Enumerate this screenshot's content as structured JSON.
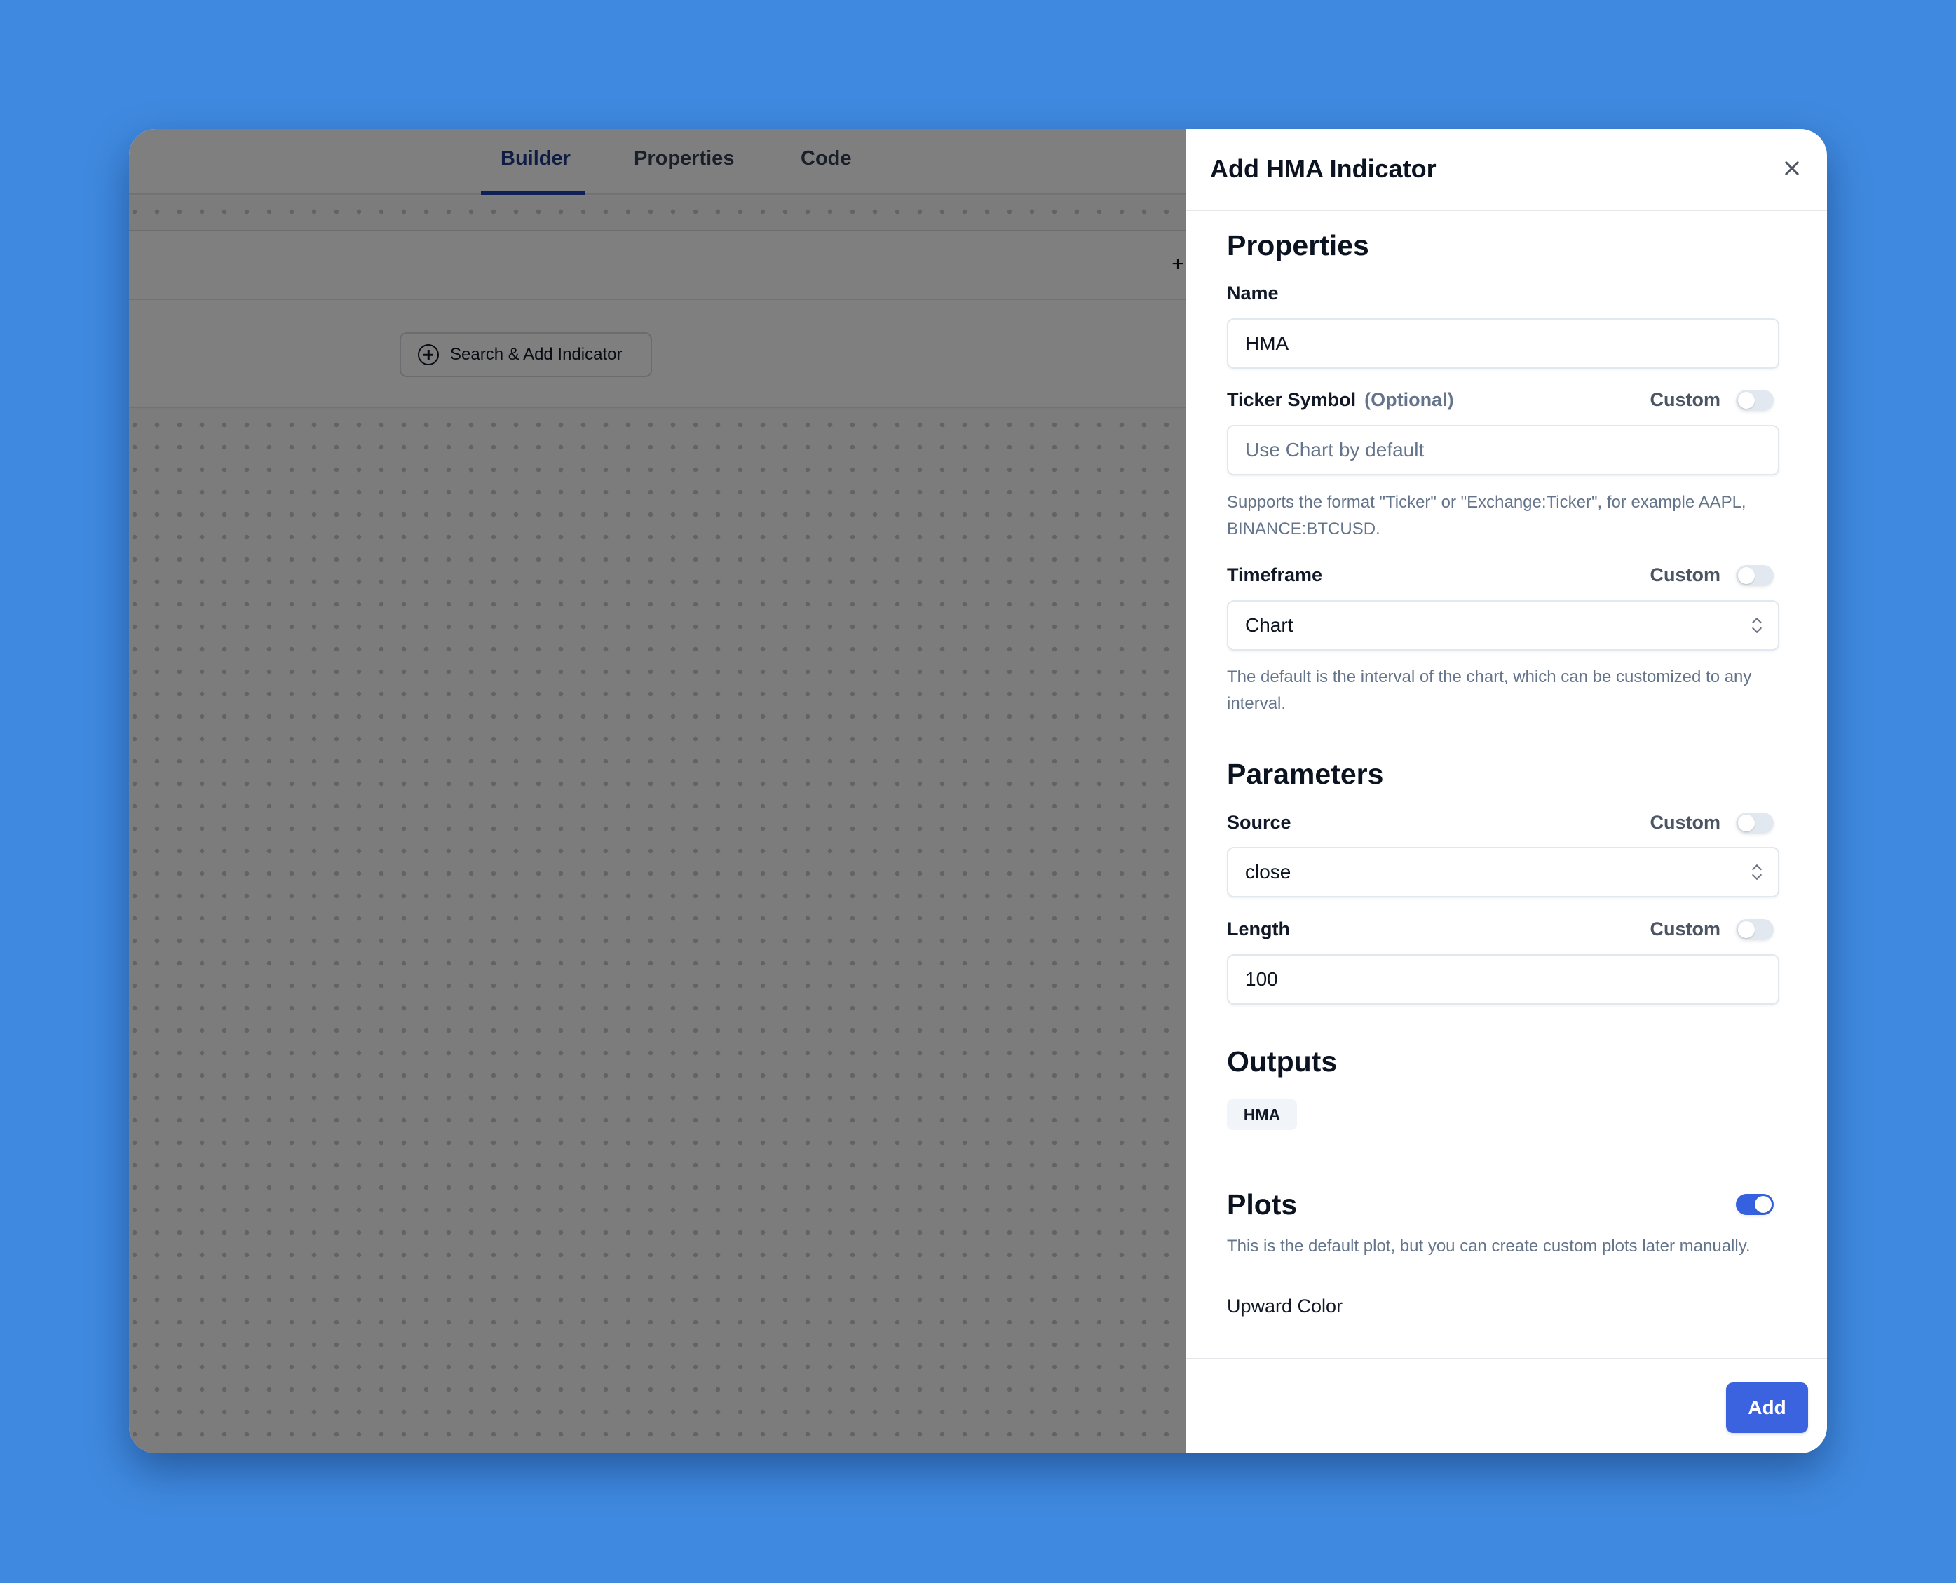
{
  "builder": {
    "tabs": [
      {
        "label": "Builder",
        "active": true
      },
      {
        "label": "Properties",
        "active": false
      },
      {
        "label": "Code",
        "active": false
      }
    ],
    "toolbar_add_symbol": "+",
    "search_add_indicator_label": "Search & Add Indicator"
  },
  "dialog": {
    "title": "Add HMA Indicator",
    "close_icon": "close-icon",
    "sections": {
      "properties": {
        "heading": "Properties",
        "name": {
          "label": "Name",
          "value": "HMA"
        },
        "ticker": {
          "label": "Ticker Symbol",
          "optional_label": "(Optional)",
          "custom_label": "Custom",
          "custom_enabled": false,
          "value": "",
          "placeholder": "Use Chart by default",
          "help": "Supports the format \"Ticker\" or \"Exchange:Ticker\", for example AAPL, BINANCE:BTCUSD."
        },
        "timeframe": {
          "label": "Timeframe",
          "custom_label": "Custom",
          "custom_enabled": false,
          "value": "Chart",
          "help": "The default is the interval of the chart, which can be customized to any interval."
        }
      },
      "parameters": {
        "heading": "Parameters",
        "source": {
          "label": "Source",
          "custom_label": "Custom",
          "custom_enabled": false,
          "value": "close"
        },
        "length": {
          "label": "Length",
          "custom_label": "Custom",
          "custom_enabled": false,
          "value": "100"
        }
      },
      "outputs": {
        "heading": "Outputs",
        "items": [
          "HMA"
        ]
      },
      "plots": {
        "heading": "Plots",
        "enabled": true,
        "help": "This is the default plot, but you can create custom plots later manually.",
        "upward_color_label": "Upward Color"
      }
    },
    "footer": {
      "add_label": "Add"
    }
  },
  "colors": {
    "background": "#3f8ae0",
    "accent": "#3b63e0",
    "active_tab": "#1e40af"
  }
}
